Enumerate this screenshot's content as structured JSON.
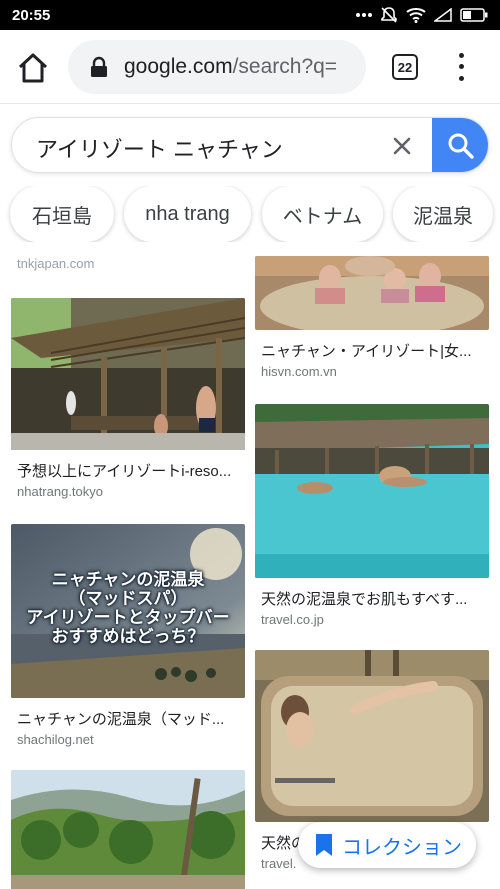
{
  "status_bar": {
    "time": "20:55",
    "icons": [
      "dots-icon",
      "mute-icon",
      "wifi-icon",
      "signal-icon",
      "battery-icon"
    ]
  },
  "browser": {
    "url_host": "google.com",
    "url_path": "/search?q=",
    "tab_count": "22",
    "icons": [
      "home-icon",
      "lock-icon",
      "menu-icon"
    ]
  },
  "search": {
    "query": "アイリゾート ニャチャン",
    "icons": [
      "close-icon",
      "search-icon"
    ],
    "accent_color": "#4285f4"
  },
  "chips": [
    {
      "label": "石垣島"
    },
    {
      "label": "nha trang"
    },
    {
      "label": "ベトナム"
    },
    {
      "label": "泥温泉"
    }
  ],
  "results": {
    "top_partial_domain": "tnkjapan.com",
    "left_column": [
      {
        "title": "予想以上にアイリゾートi-reso...",
        "domain": "nhatrang.tokyo",
        "image": "outdoor-pavilion-photo"
      },
      {
        "title": "ニャチャンの泥温泉（マッド...",
        "domain": "shachilog.net",
        "image": "beach-title-card",
        "overlay_text": [
          "ニャチャンの泥温泉",
          "（マッドスパ）",
          "アイリゾートとタップバー",
          "おすすめはどっち？"
        ]
      },
      {
        "title": "",
        "domain": "",
        "image": "hillside-garden-photo"
      }
    ],
    "right_column": [
      {
        "title": "ニャチャン・アイリゾート|女...",
        "domain": "hisvn.com.vn",
        "image": "mud-bath-kids-photo"
      },
      {
        "title": "天然の泥温泉でお肌もすべす...",
        "domain": "travel.co.jp",
        "image": "hot-spring-pool-photo"
      },
      {
        "title": "天然の",
        "domain": "travel.",
        "image": "mud-tub-photo"
      }
    ]
  },
  "collection_button": {
    "label": "コレクション",
    "icon": "bookmark-icon",
    "color": "#1a73e8"
  }
}
